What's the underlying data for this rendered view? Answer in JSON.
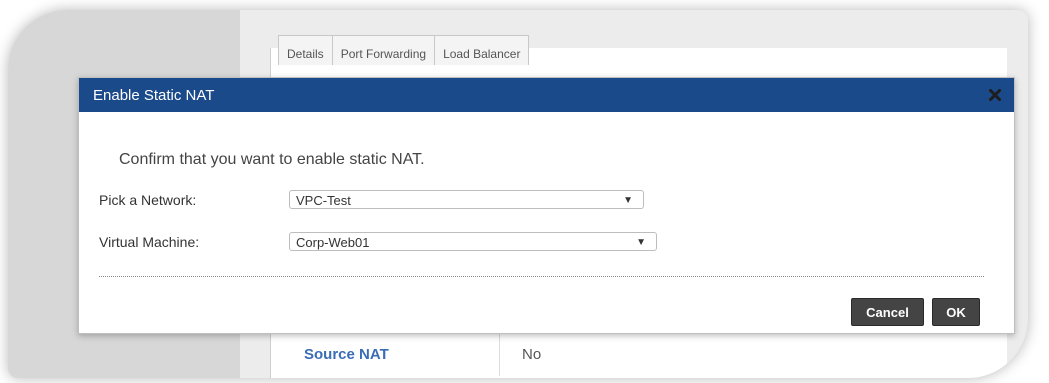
{
  "tabs": [
    {
      "label": "Details"
    },
    {
      "label": "Port Forwarding"
    },
    {
      "label": "Load Balancer"
    }
  ],
  "detail": {
    "key": "Source NAT",
    "value": "No"
  },
  "modal": {
    "title": "Enable Static NAT",
    "confirm_text": "Confirm that you want to enable static NAT.",
    "network_label": "Pick a Network:",
    "network_value": "VPC-Test",
    "vm_label": "Virtual Machine:",
    "vm_value": "Corp-Web01",
    "cancel_label": "Cancel",
    "ok_label": "OK"
  },
  "colors": {
    "header_blue": "#1a4a8a",
    "link_blue": "#3a6db5",
    "button_dark": "#444444"
  },
  "icons": {
    "close": "close-icon",
    "dropdown": "dropdown-arrow-icon"
  }
}
